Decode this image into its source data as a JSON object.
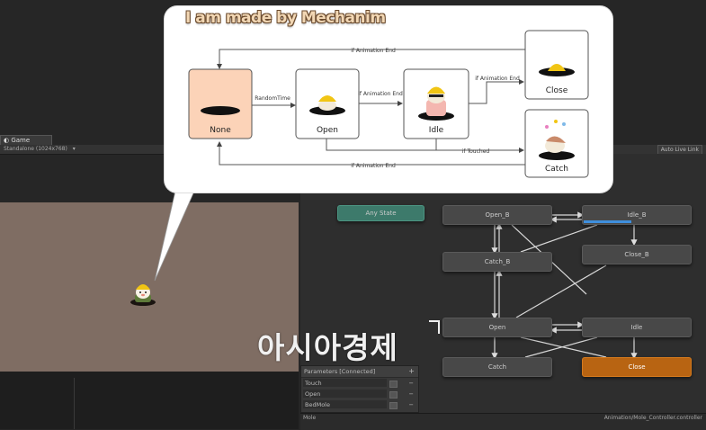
{
  "game": {
    "tab_label": "Game",
    "resolution": "Standalone (1024x768)"
  },
  "animator": {
    "auto_live_link": "Auto Live Link",
    "states": {
      "any_state": "Any State",
      "open_b": "Open_B",
      "idle_b": "Idle_B",
      "catch_b": "Catch_B",
      "close_b": "Close_B",
      "open": "Open",
      "idle": "Idle",
      "catch": "Catch",
      "close": "Close"
    },
    "idle_b_progress": 0.45,
    "parameters": {
      "header": "Parameters [Connected]",
      "add_label": "+",
      "items": [
        {
          "name": "Touch",
          "remove": "−"
        },
        {
          "name": "Open",
          "remove": "−"
        },
        {
          "name": "BedMole",
          "remove": "−"
        }
      ]
    },
    "status": {
      "left": "Mole",
      "right": "Animation/Mole_Controller.controller"
    }
  },
  "bubble": {
    "title": "I am made by Mechanim",
    "nodes": {
      "none": "None",
      "open": "Open",
      "idle": "Idle",
      "close": "Close",
      "catch": "Catch"
    },
    "edges": {
      "random_time": "RandomTime",
      "anim_end_top": "if Animation End",
      "anim_end_open_idle": "if Animation End",
      "anim_end_idle_close": "if Animation End",
      "if_touched": "if Touched",
      "anim_end_bottom": "if Animation End"
    }
  },
  "watermark": "아시아경제",
  "colors": {
    "any_state": "#3d7a6b",
    "active_state": "#b86412",
    "none_node": "#fcd3b8",
    "progress": "#3f8fdd"
  }
}
